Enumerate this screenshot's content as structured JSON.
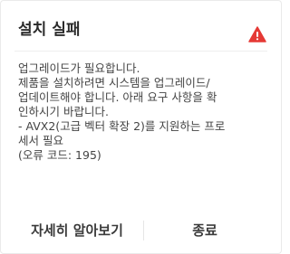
{
  "dialog": {
    "title": "설치 실패",
    "icon": "warning-triangle-icon",
    "icon_color": "#e53935",
    "message_lines": [
      "업그레이드가 필요합니다.",
      "제품을 설치하려면 시스템을 업그레이드/",
      "업데이트해야 합니다. 아래 요구 사항을 확",
      "인하시기 바랍니다.",
      "- AVX2(고급 벡터 확장 2)를 지원하는 프로",
      "세서 필요",
      "(오류 코드: 195)"
    ],
    "buttons": {
      "learn_more": "자세히 알아보기",
      "close": "종료"
    }
  }
}
